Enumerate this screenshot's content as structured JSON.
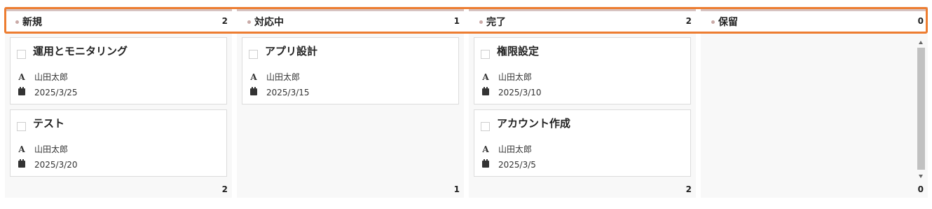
{
  "board": {
    "columns": [
      {
        "title": "新規",
        "count": "2",
        "footer_count": "2",
        "cards": [
          {
            "title": "運用とモニタリング",
            "assignee": "山田太郎",
            "due": "2025/3/25"
          },
          {
            "title": "テスト",
            "assignee": "山田太郎",
            "due": "2025/3/20"
          }
        ]
      },
      {
        "title": "対応中",
        "count": "1",
        "footer_count": "1",
        "cards": [
          {
            "title": "アプリ設計",
            "assignee": "山田太郎",
            "due": "2025/3/15"
          }
        ]
      },
      {
        "title": "完了",
        "count": "2",
        "footer_count": "2",
        "cards": [
          {
            "title": "権限設定",
            "assignee": "山田太郎",
            "due": "2025/3/10"
          },
          {
            "title": "アカウント作成",
            "assignee": "山田太郎",
            "due": "2025/3/5"
          }
        ]
      },
      {
        "title": "保留",
        "count": "0",
        "footer_count": "0",
        "cards": []
      }
    ]
  },
  "icons": {
    "assignee": "person-icon",
    "due": "calendar-icon"
  },
  "colors": {
    "highlight": "#ed7d31",
    "header_bar": "#d7c3c1",
    "column_bg": "#f8f8f8"
  }
}
